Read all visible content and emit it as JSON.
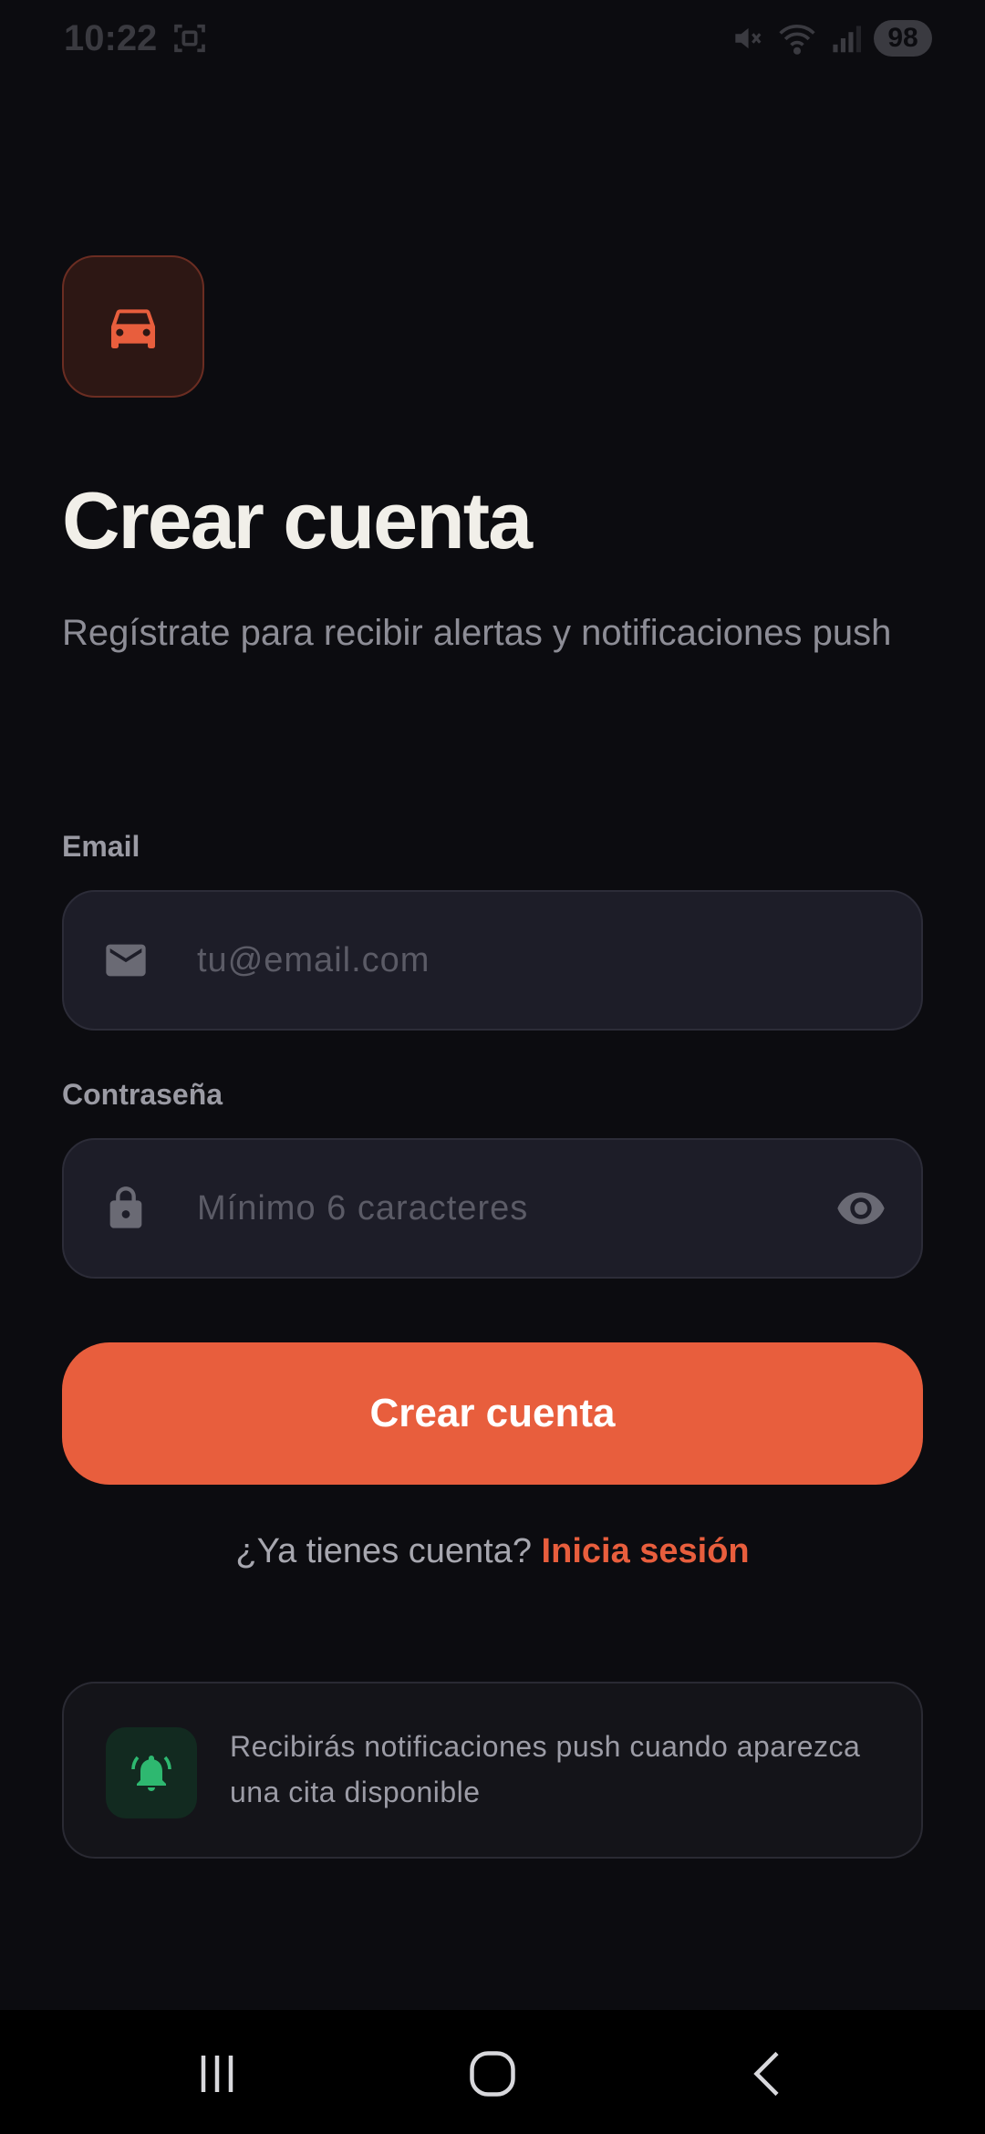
{
  "status_bar": {
    "time": "10:22",
    "battery": "98",
    "icons": [
      "screenshot-icon",
      "mute-icon",
      "wifi-icon",
      "signal-icon",
      "battery-icon"
    ]
  },
  "logo": {
    "icon": "car-icon",
    "accent": "#e85e3d"
  },
  "header": {
    "title": "Crear cuenta",
    "subtitle": "Regístrate para recibir alertas y notificaciones push"
  },
  "form": {
    "email": {
      "label": "Email",
      "value": "",
      "placeholder": "tu@email.com",
      "icon": "mail-icon"
    },
    "password": {
      "label": "Contraseña",
      "value": "",
      "placeholder": "Mínimo 6 caracteres",
      "icon": "lock-icon",
      "toggle_icon": "eye-icon"
    },
    "submit_label": "Crear cuenta"
  },
  "signin": {
    "prompt": "¿Ya tienes cuenta?",
    "link": "Inicia sesión"
  },
  "info_card": {
    "icon": "bell-ring-icon",
    "text": "Recibirás notificaciones push cuando aparezca una cita disponible"
  },
  "colors": {
    "background": "#0c0c10",
    "accent": "#e85e3d",
    "field_bg": "#1d1d28",
    "success": "#2eb870"
  },
  "nav_bar": {
    "icons": [
      "recents-icon",
      "home-icon",
      "back-icon"
    ]
  }
}
